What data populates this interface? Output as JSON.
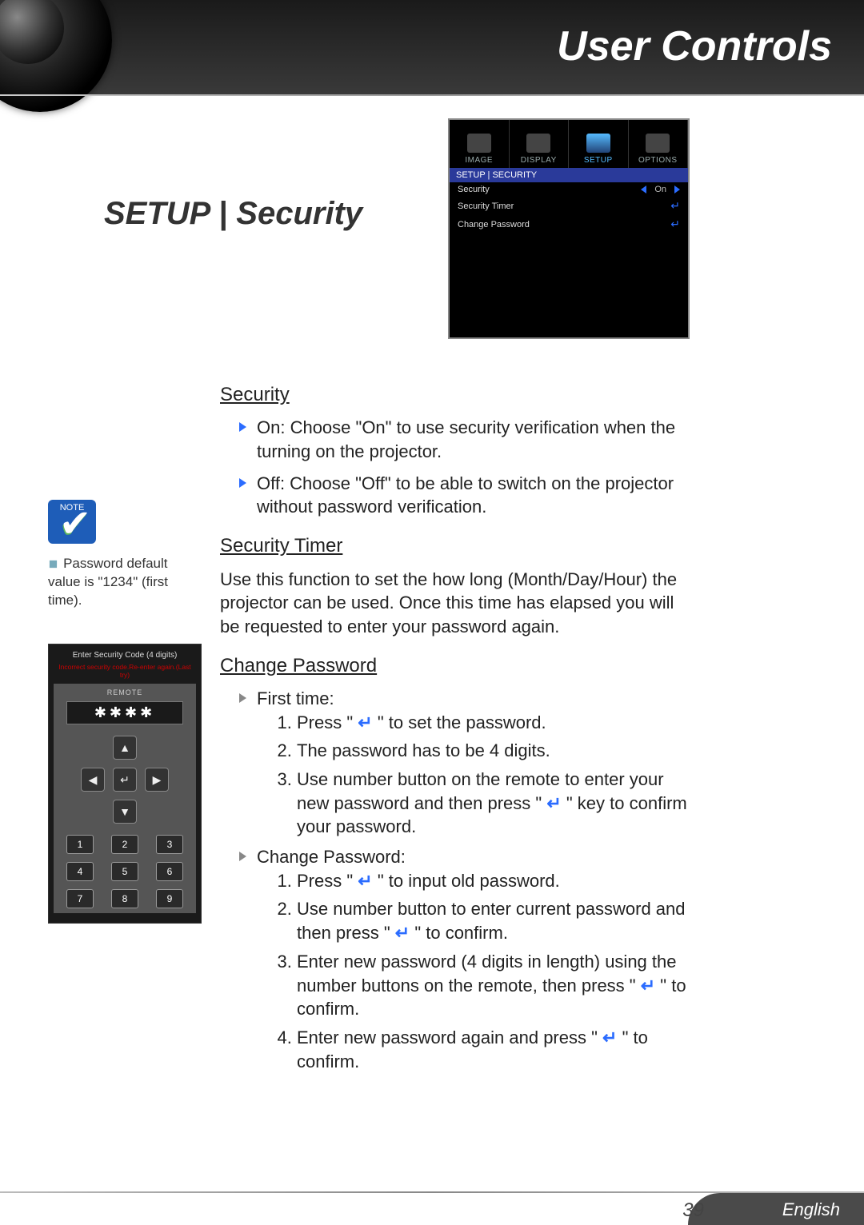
{
  "header": {
    "title": "User Controls"
  },
  "page": {
    "title": "SETUP | Security"
  },
  "osd": {
    "tabs": [
      "IMAGE",
      "DISPLAY",
      "SETUP",
      "OPTIONS"
    ],
    "active_tab_index": 2,
    "breadcrumb": "SETUP | SECURITY",
    "rows": [
      {
        "label": "Security",
        "value": "On",
        "has_arrows": true
      },
      {
        "label": "Security Timer",
        "value": "",
        "has_enter": true
      },
      {
        "label": "Change Password",
        "value": "",
        "has_enter": true
      }
    ]
  },
  "sections": {
    "security": {
      "title": "Security",
      "items": [
        "On: Choose \"On\" to use security verification when the turning on the projector.",
        "Off: Choose \"Off\" to be able to switch on the projector without password verification."
      ]
    },
    "security_timer": {
      "title": "Security Timer",
      "body": "Use this function to set the how long (Month/Day/Hour) the projector can be used. Once this time has elapsed you will be requested to enter your password again."
    },
    "change_password": {
      "title": "Change Password",
      "first_time_label": "First time:",
      "first_time_steps": [
        {
          "pre": "Press \" ",
          "post": " \" to set the password."
        },
        {
          "text": "The password has to be 4 digits."
        },
        {
          "pre": "Use number button on the remote to enter your new password and then press \" ",
          "post": " \" key to confirm your password."
        }
      ],
      "change_label": "Change Password:",
      "change_steps": [
        {
          "pre": "Press \" ",
          "post": " \" to input old password."
        },
        {
          "pre": "Use number button to enter current password and then press \" ",
          "post": " \" to confirm."
        },
        {
          "pre": "Enter new password (4 digits in length) using the number buttons on the remote, then press \" ",
          "post": " \" to confirm."
        },
        {
          "pre": "Enter new password again and press \" ",
          "post": " \" to confirm."
        }
      ]
    }
  },
  "note": {
    "badge": "NOTE",
    "text": "Password default value is \"1234\" (first time)."
  },
  "remote": {
    "title": "Enter Security Code (4 digits)",
    "error": "Incorrect security code.Re-enter again.(Last try)",
    "label": "REMOTE",
    "display": "✱✱✱✱",
    "numpad": [
      "1",
      "2",
      "3",
      "4",
      "5",
      "6",
      "7",
      "8",
      "9"
    ]
  },
  "footer": {
    "page": "39",
    "lang": "English"
  },
  "icons": {
    "enter": "↵"
  }
}
